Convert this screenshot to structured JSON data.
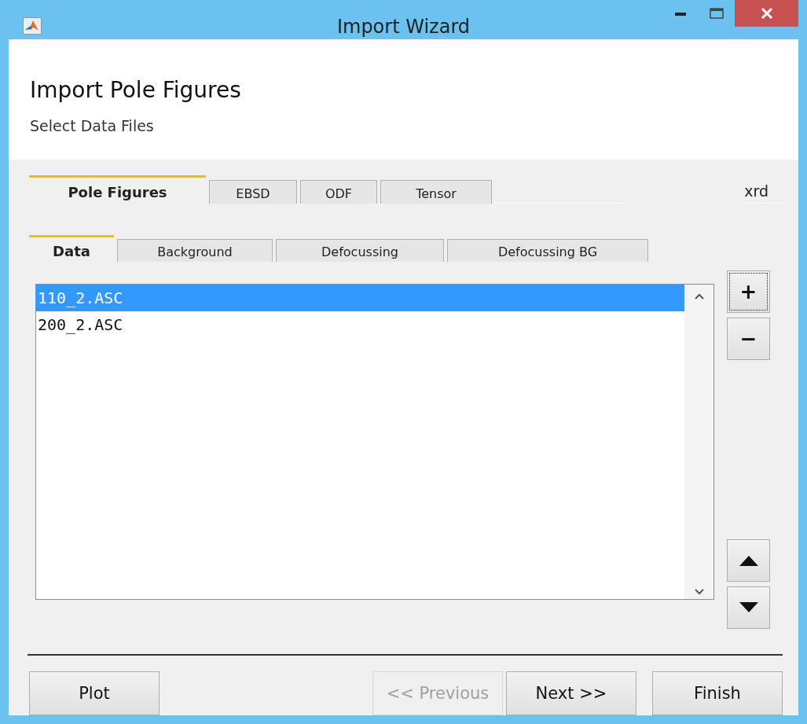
{
  "window": {
    "title": "Import Wizard"
  },
  "header": {
    "title": "Import Pole Figures",
    "subtitle": "Select Data Files"
  },
  "tabs": [
    {
      "label": "Pole Figures",
      "selected": true
    },
    {
      "label": "EBSD",
      "selected": false
    },
    {
      "label": "ODF",
      "selected": false
    },
    {
      "label": "Tensor",
      "selected": false
    }
  ],
  "tab_note": "xrd",
  "subtabs": [
    {
      "label": "Data",
      "selected": true
    },
    {
      "label": "Background",
      "selected": false
    },
    {
      "label": "Defocussing",
      "selected": false
    },
    {
      "label": "Defocussing BG",
      "selected": false
    }
  ],
  "files": [
    {
      "name": "110_2.ASC",
      "selected": true
    },
    {
      "name": "200_2.ASC",
      "selected": false
    }
  ],
  "side_buttons": [
    {
      "label": "+",
      "focused": true
    },
    {
      "label": "−",
      "focused": false
    }
  ],
  "order_buttons": [
    {
      "kind": "up"
    },
    {
      "kind": "down"
    }
  ],
  "left_buttons": [
    {
      "label": "Plot",
      "disabled": false
    }
  ],
  "nav_buttons": [
    {
      "label": "<< Previous",
      "disabled": true
    },
    {
      "label": "Next >>",
      "disabled": false
    }
  ],
  "right_buttons": [
    {
      "label": "Finish",
      "disabled": false
    }
  ]
}
